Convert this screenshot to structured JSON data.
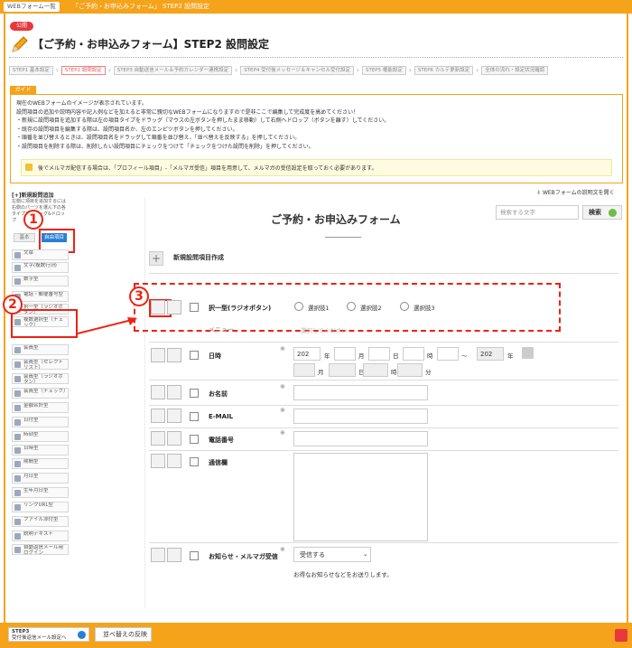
{
  "topbar": {
    "crumb1": "WEBフォーム一覧",
    "current": "「ご予約・お申込みフォーム」 STEP2 設問設定"
  },
  "header": {
    "badge": "公開",
    "title": "【ご予約・お申込みフォーム】STEP2 設問設定"
  },
  "steps": [
    "STEP1 基本設定",
    "STEP2 設問設定",
    "STEP3 自動送信メール＆予約カレンダー連携設定",
    "STEP4 受付後メッセージ＆キャンセル受付設定",
    "STEP5 権能設定",
    "STEP6 カルテ更新設定",
    "全体の流れ・設定状況確認"
  ],
  "guide": {
    "tag": "ガイド",
    "lines": [
      "現在のWEBフォームのイメージが表示されています。",
      "設問項目の追加や説明内容や記入例などを加えると非常に親切なWEBフォームになりますので是非ここで編集して完成度を高めてください！",
      "・新規に設問項目を追加する際は左の項目タイプをドラッグ（マウスの左ボタンを押したまま移動）して右側へドロップ（ボタンを離す）してください。",
      "・既存の設問項目を編集する際は、設問項目名か、左のエンピツボタンを押してください。",
      "・順番を並び替えるときは、設問項目名をドラッグして順番を並び替え、「並べ替えを反映する」を押してください。",
      "・設問項目を削除する際は、削除したい設問項目にチェックをつけて「チェックをつけた設問を削除」を押してください。"
    ],
    "note": "後でメルマガ配信する場合は、「プロフィール項目」-「メルマガ受信」項目を用意して、メルマガの受信設定を取っておく必要があります。"
  },
  "sidebar": {
    "title": "[+]新規設問追加",
    "desc": "左側に項目を追加するには右側のパーツを選ん下の各タイプをドラッグ&ドロップ",
    "tab_a": "基本",
    "tab_b": "自由項目",
    "items": [
      "文章",
      "文字(複数行)形",
      "数字型",
      "電話・郵便番号型",
      "択一型（ラジオボタン）",
      "複数選択型（チェック）",
      "会員型",
      "会員型（セレクトリスト）",
      "会員型（ラジオボタン）",
      "会員型（チェック）",
      "金額合計型",
      "日付型",
      "時刻型",
      "日時型",
      "期間型",
      "月日型",
      "生年月日型",
      "リンクURL型",
      "ファイル添付型",
      "説明テキスト",
      "自動返信メール用ログイン"
    ]
  },
  "annotations": {
    "n1": "1",
    "n2": "2",
    "n3": "3"
  },
  "form": {
    "help": "WEBフォームの説明文を開く",
    "title": "ご予約・お申込みフォーム",
    "search_placeholder": "検索する文字",
    "search_btn": "検索",
    "new_question": "新規設問項目作成",
    "q_radio": "択一型(ラジオボタン)",
    "radio_opts": [
      "選択肢1",
      "選択肢2",
      "選択肢3"
    ],
    "q_menu": "メニュー",
    "menu_placeholder": "選択してください",
    "q_date": "日時",
    "year1": "202",
    "year2": "202",
    "y": "年",
    "m": "月",
    "d": "日",
    "h": "時",
    "min": "分",
    "tilde": "～",
    "q_name": "お名前",
    "q_email": "E-MAIL",
    "q_phone": "電話番号",
    "q_message": "通信欄",
    "q_mag": "お知らせ・メルマガ受信",
    "mag_select": "受信する",
    "mag_note": "お得なお知らせなどをお送りします。",
    "ast": "※"
  },
  "footer": {
    "btn1_line1": "STEP3",
    "btn1_line2": "受付後返信メール設定へ",
    "btn2": "並べ替えの反映"
  },
  "colors": {
    "orange": "#f5a31a",
    "red": "#e21",
    "blue": "#2a7fd4"
  }
}
